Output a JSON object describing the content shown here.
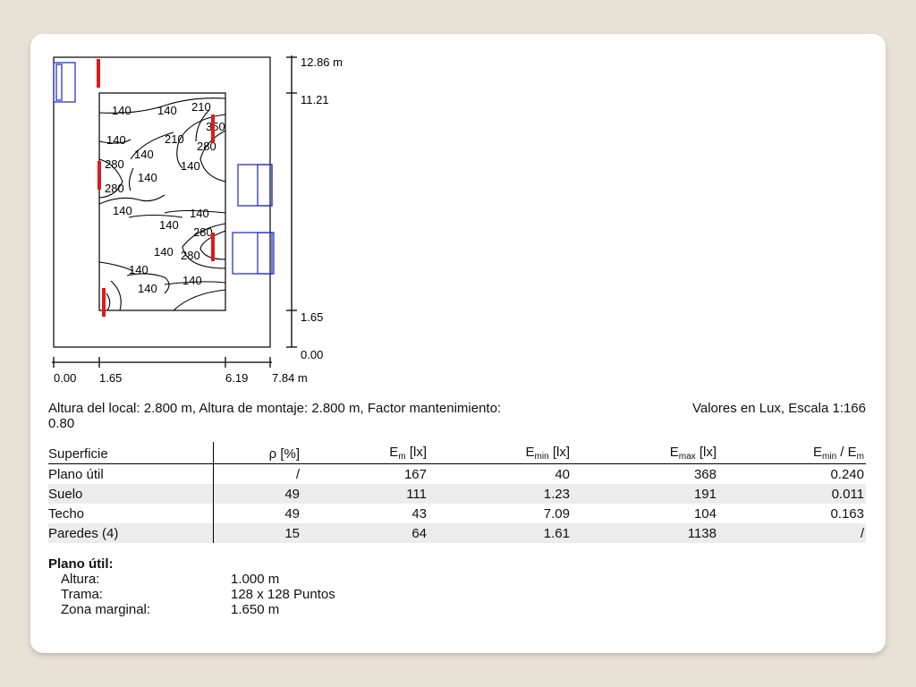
{
  "plan": {
    "y_axis_ticks": [
      "12.86 m",
      "11.21",
      "1.65",
      "0.00"
    ],
    "x_axis_ticks": [
      "0.00",
      "1.65",
      "6.19",
      "7.84 m"
    ],
    "contour_labels": [
      "140",
      "140",
      "210",
      "350",
      "140",
      "210",
      "280",
      "280",
      "140",
      "140",
      "280",
      "140",
      "140",
      "140",
      "140",
      "280",
      "140",
      "280",
      "140",
      "140",
      "140"
    ]
  },
  "info": {
    "left": "Altura del local: 2.800 m, Altura de montaje: 2.800 m, Factor mantenimiento: 0.80",
    "right": "Valores en Lux, Escala 1:166"
  },
  "table": {
    "headers": [
      "Superficie",
      "ρ [%]",
      "E",
      "m",
      " [lx]",
      "E",
      "min",
      " [lx]",
      "E",
      "max",
      " [lx]",
      "E",
      "min",
      " / E",
      "m"
    ],
    "rows": [
      [
        "Plano útil",
        "/",
        "167",
        "40",
        "368",
        "0.240"
      ],
      [
        "Suelo",
        "49",
        "111",
        "1.23",
        "191",
        "0.011"
      ],
      [
        "Techo",
        "49",
        "43",
        "7.09",
        "104",
        "0.163"
      ],
      [
        "Paredes (4)",
        "15",
        "64",
        "1.61",
        "1138",
        "/"
      ]
    ]
  },
  "params": {
    "title": "Plano útil:",
    "items": [
      {
        "label": "Altura:",
        "value": "1.000 m"
      },
      {
        "label": "Trama:",
        "value": "128 x 128 Puntos"
      },
      {
        "label": "Zona marginal:",
        "value": "1.650 m"
      }
    ]
  },
  "colors": {
    "luminaire": "#e0191b",
    "furniture": "#2a34c8",
    "background": "#e8e1d6"
  }
}
